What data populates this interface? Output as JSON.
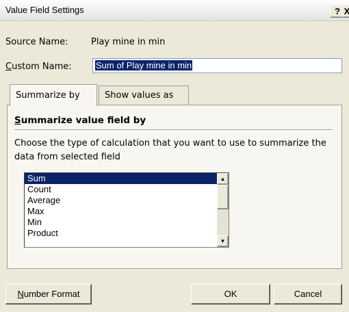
{
  "window": {
    "title": "Value Field Settings",
    "help_glyph": "?",
    "close_glyph": "X"
  },
  "source": {
    "label": "Source Name:",
    "value": "Play mine in min"
  },
  "custom": {
    "label_first": "C",
    "label_rest": "ustom Name:",
    "value": "Sum of Play mine in min"
  },
  "tabs": [
    {
      "label": "Summarize by",
      "active": true
    },
    {
      "label": "Show values as",
      "active": false
    }
  ],
  "panel": {
    "heading_first": "S",
    "heading_rest": "ummarize value field by",
    "description": "Choose the type of calculation that you want to use to summarize the data from selected field",
    "list": {
      "items": [
        "Sum",
        "Count",
        "Average",
        "Max",
        "Min",
        "Product"
      ],
      "selected": "Sum"
    },
    "scroll_up_glyph": "▲",
    "scroll_down_glyph": "▼"
  },
  "buttons": {
    "number_format_first": "N",
    "number_format_rest": "umber Format",
    "ok": "OK",
    "cancel": "Cancel"
  },
  "colors": {
    "selection": "#0a246a",
    "dialog_bg": "#ece9d8"
  }
}
